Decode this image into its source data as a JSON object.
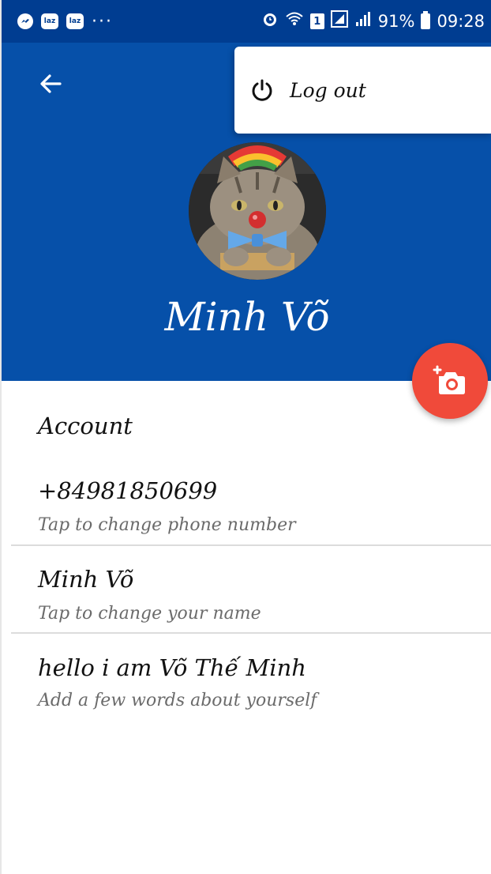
{
  "status_bar": {
    "left_icons": [
      "messenger-icon",
      "lazada-icon",
      "lazada-icon"
    ],
    "laz_label": "laz",
    "more": "···",
    "sim_label": "1",
    "battery_percent": "91%",
    "time": "09:28"
  },
  "header": {
    "back_icon": "arrow-left-icon",
    "name": "Minh Võ",
    "avatar": "cat-avatar"
  },
  "menu": {
    "logout_label": "Log out",
    "logout_icon": "power-icon"
  },
  "fab": {
    "icon": "add-camera-icon"
  },
  "account": {
    "section_title": "Account",
    "items": [
      {
        "value": "+84981850699",
        "hint": "Tap to change phone number"
      },
      {
        "value": "Minh Võ",
        "hint": "Tap to change your name"
      },
      {
        "value": "hello i am Võ Thế Minh",
        "hint": "Add a few words about yourself"
      }
    ]
  },
  "colors": {
    "header_bg": "#0650a9",
    "status_bg": "#003d91",
    "fab_bg": "#f04a3a"
  }
}
